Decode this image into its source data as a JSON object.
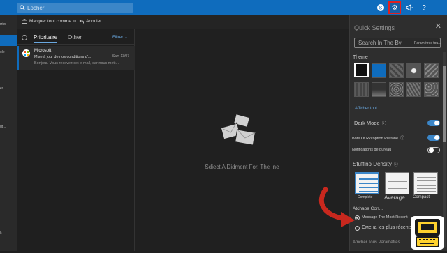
{
  "header": {
    "search_placeholder": "Locher",
    "gear_label": "⚙",
    "megaphone_label": "📣",
    "help_label": "?"
  },
  "left_nav": {
    "items": [
      "rrier",
      "ole",
      "",
      "es",
      "",
      "",
      "ut...",
      "",
      "",
      "",
      "k"
    ]
  },
  "command_bar": {
    "mark_all_read": "Marquer tout comme lu",
    "undo": "Annuler"
  },
  "message_list": {
    "tab_focused": "Prioritaire",
    "tab_other": "Other",
    "filter": "Filtrer",
    "items": [
      {
        "sender": "Microsoft",
        "subject": "Mise à jour de nos conditions d'...",
        "preview": "Bonjour. Vous recevez cet e-mail, car nous mett...",
        "date": "Sam 13/07"
      }
    ]
  },
  "reading_pane": {
    "empty_text": "Sdiect A Didment For, The Ine"
  },
  "quick_settings": {
    "title": "Quick Settings",
    "search_placeholder": "Search In The Bv",
    "search_sub": "Paramètres tou...",
    "theme_label": "Theme",
    "show_all": "Afficher tout",
    "dark_mode": "Dark Mode",
    "focused_inbox": "Bote Of Rkcoption Pleitane",
    "notifications": "Notifications de bureau",
    "density_label": "Stuffino Density",
    "density_options": [
      "Complete",
      "Average",
      "Compact"
    ],
    "conversation_label": "Atchaoa Con...",
    "radio1": "Message The Most Recent",
    "radio2": "Смена les plus récents",
    "view_all": "Amcher Tous Paramètres",
    "colors": {
      "accent": "#0f6cbd",
      "themes": [
        "#111111",
        "#0f6cbd",
        "#555555",
        "#666666",
        "#777777",
        "#606060",
        "#585858",
        "#4a4a4a",
        "#6a6a6a",
        "#5a5a5a",
        "#707070",
        "#7a7a7a"
      ]
    }
  }
}
